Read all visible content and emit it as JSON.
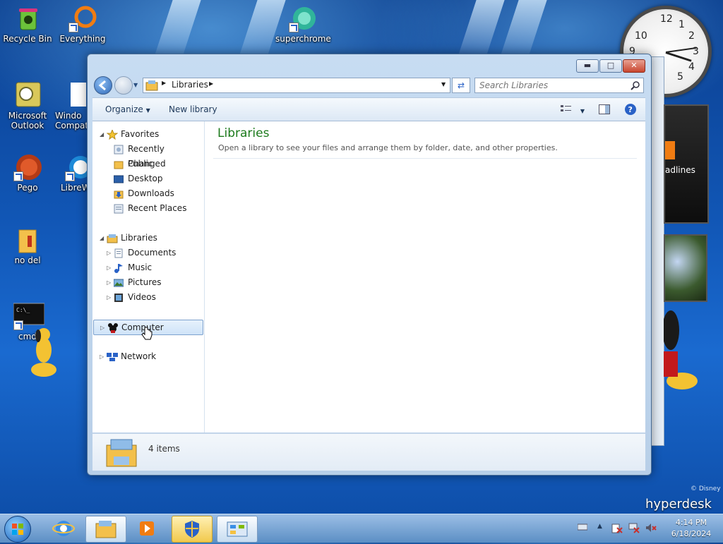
{
  "desktop": {
    "icons": [
      {
        "label": "Recycle Bin"
      },
      {
        "label": "Everything"
      },
      {
        "label": "superchrome"
      },
      {
        "label": "Microsoft Outlook"
      },
      {
        "label": "Windo Compat"
      },
      {
        "label": "Pego"
      },
      {
        "label": "LibreW"
      },
      {
        "label": "no del"
      },
      {
        "label": "cmd"
      }
    ],
    "gadget_headlines": "adlines",
    "clock_numbers": [
      "12",
      "1",
      "2",
      "3",
      "4",
      "5",
      "10",
      "9"
    ],
    "watermark": {
      "disney": "© Disney",
      "brand": "hyperdesk"
    }
  },
  "window": {
    "address": {
      "crumb": "Libraries"
    },
    "search": {
      "placeholder": "Search Libraries"
    },
    "toolbar": {
      "organize": "Organize",
      "new_library": "New library"
    },
    "nav": {
      "favorites": "Favorites",
      "favorites_items": [
        "Recently Changed",
        "Public",
        "Desktop",
        "Downloads",
        "Recent Places"
      ],
      "libraries": "Libraries",
      "libraries_items": [
        "Documents",
        "Music",
        "Pictures",
        "Videos"
      ],
      "computer": "Computer",
      "network": "Network"
    },
    "main": {
      "title": "Libraries",
      "subtitle": "Open a library to see your files and arrange them by folder, date, and other properties."
    },
    "status": {
      "items": "4 items"
    }
  },
  "taskbar": {
    "time": "4:14 PM",
    "date": "6/18/2024"
  },
  "colors": {
    "accent_green": "#1c7a1c",
    "selection": "#cce4f7"
  }
}
